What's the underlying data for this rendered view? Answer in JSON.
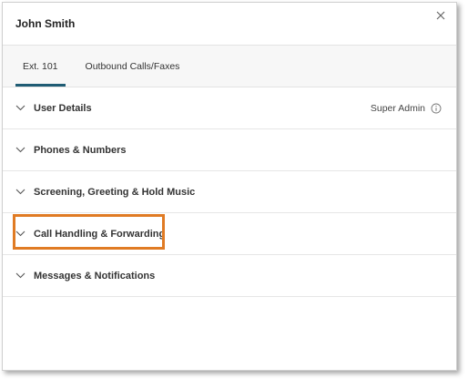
{
  "dialog": {
    "title": "John Smith",
    "close_icon": "close-icon"
  },
  "tabs": [
    {
      "label": "Ext. 101",
      "active": true
    },
    {
      "label": "Outbound Calls/Faxes",
      "active": false
    }
  ],
  "sections": [
    {
      "label": "User Details",
      "role": "Super Admin",
      "role_icon": "info-icon"
    },
    {
      "label": "Phones & Numbers"
    },
    {
      "label": "Screening, Greeting & Hold Music"
    },
    {
      "label": "Call Handling & Forwarding",
      "highlighted": true
    },
    {
      "label": "Messages & Notifications"
    }
  ],
  "colors": {
    "accent": "#1f5c74",
    "highlight": "#e07b24"
  }
}
